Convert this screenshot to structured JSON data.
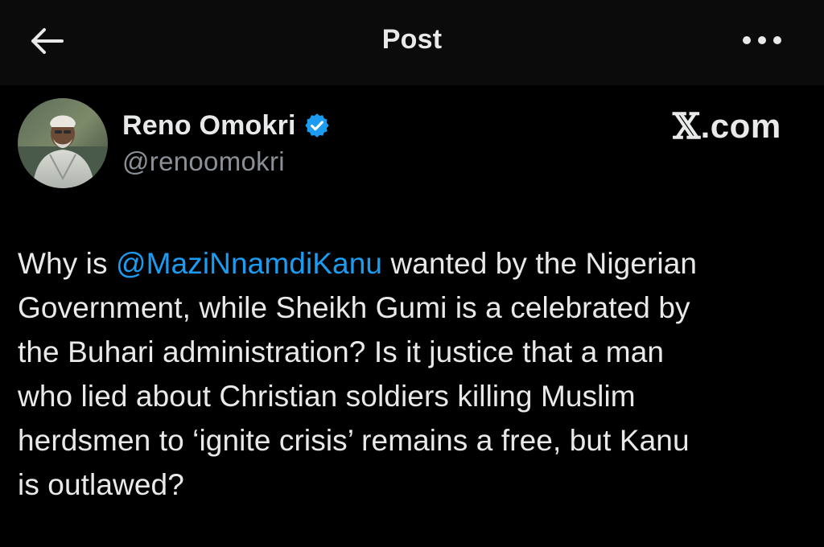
{
  "header": {
    "title": "Post",
    "back_icon": "back-arrow-icon",
    "more_icon": "more-horizontal-icon"
  },
  "author": {
    "display_name": "Reno Omokri",
    "handle": "@renoomokri",
    "verified": true,
    "verified_color": "#1d9bf0",
    "avatar": "avatar-photo"
  },
  "watermark": "X.com",
  "watermark_rest": ".com",
  "tweet": {
    "lines": [
      {
        "before": "Why is ",
        "mention": "@MaziNnamdiKanu",
        "after": " wanted by the Nigerian"
      },
      {
        "text": "Government, while Sheikh Gumi is a celebrated by"
      },
      {
        "text": "the Buhari administration? Is it justice that a man"
      },
      {
        "text": "who lied about Christian soldiers killing Muslim"
      },
      {
        "text": "herdsmen to ‘ignite crisis’ remains a free, but Kanu"
      },
      {
        "text": "is outlawed?"
      }
    ]
  },
  "colors": {
    "background": "#000000",
    "header_bg": "#0b0b0b",
    "text": "#e7e9ea",
    "secondary_text": "#8b9097",
    "link": "#1d9bf0"
  }
}
